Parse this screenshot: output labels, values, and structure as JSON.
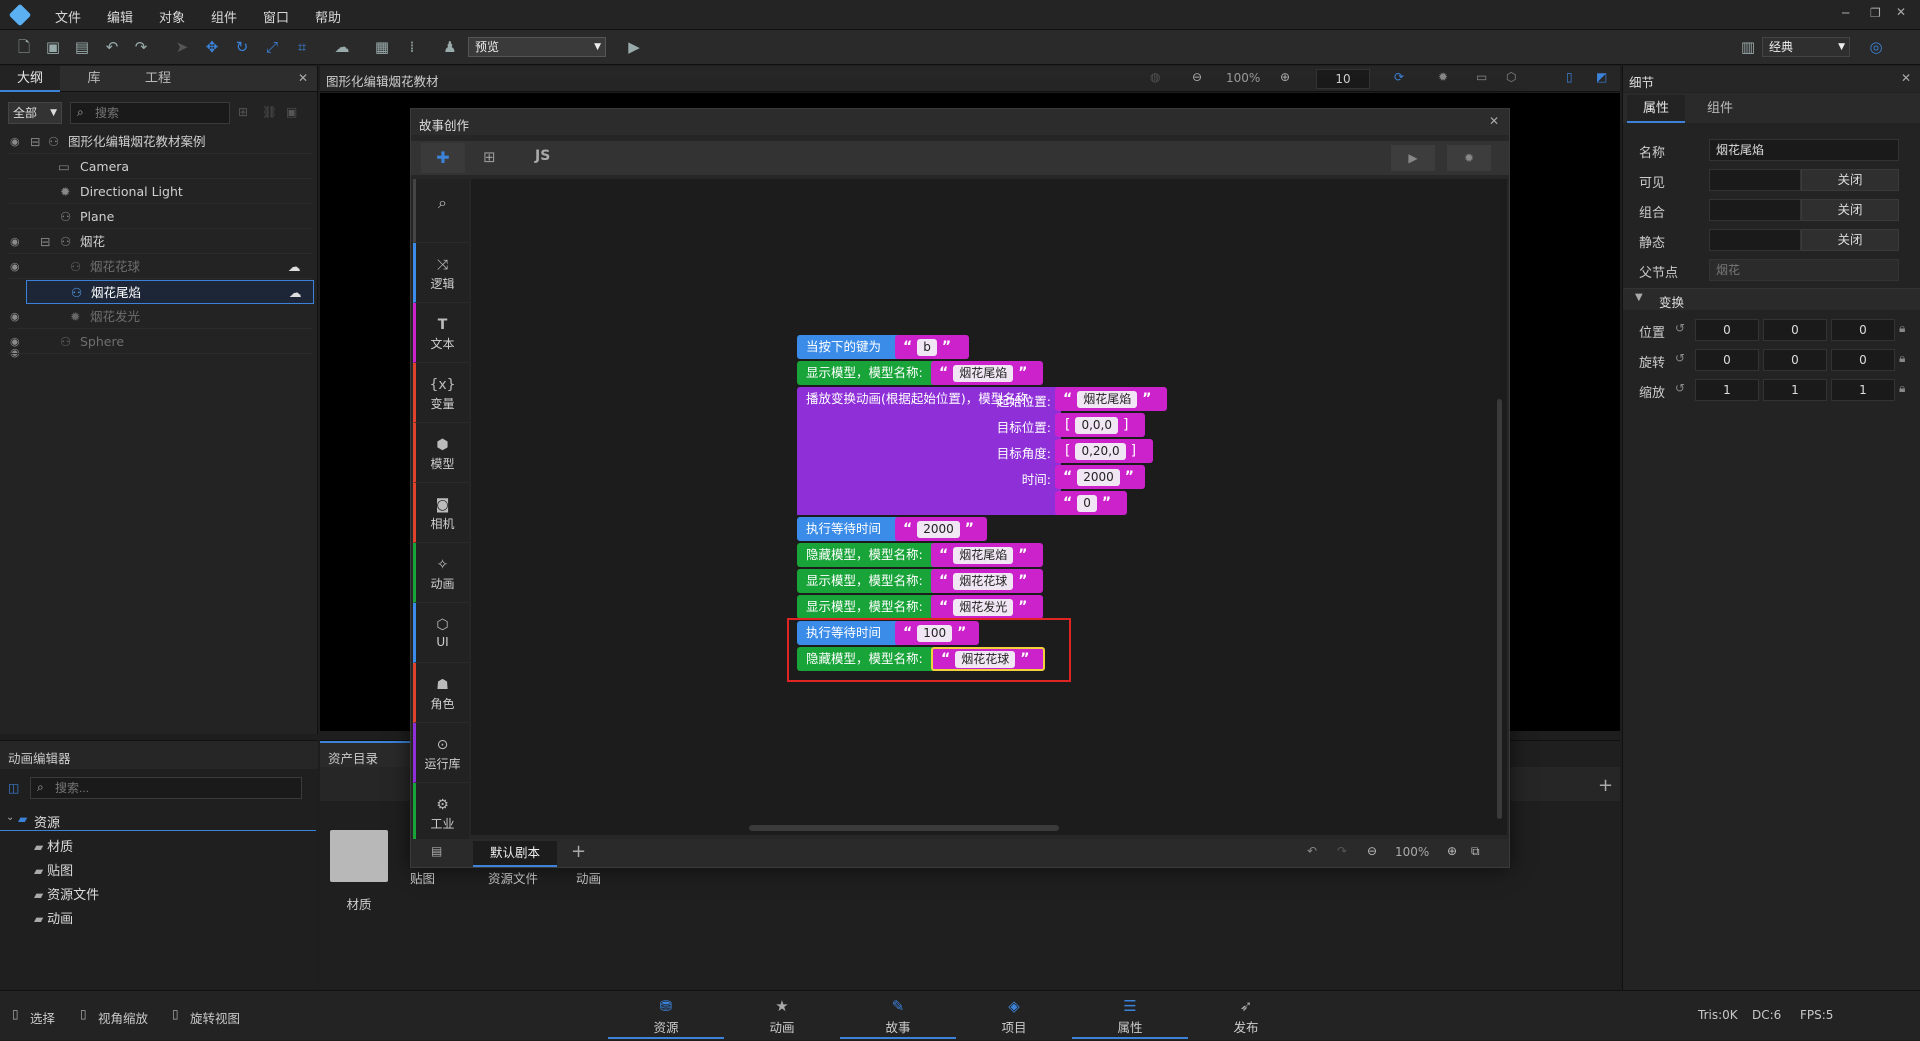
{
  "menu": [
    "文件",
    "编辑",
    "对象",
    "组件",
    "窗口",
    "帮助"
  ],
  "toolbar": {
    "preview_select": "预览",
    "layout_select": "经典"
  },
  "left_panel": {
    "tabs": [
      "大纲",
      "库",
      "工程"
    ],
    "filter_select": "全部",
    "search_placeholder": "搜索",
    "tree": [
      {
        "label": "图形化编辑烟花教材案例",
        "icon": "group-icon",
        "dim": false
      },
      {
        "label": "Camera",
        "icon": "camera-icon",
        "dim": false
      },
      {
        "label": "Directional Light",
        "icon": "light-icon",
        "dim": false
      },
      {
        "label": "Plane",
        "icon": "mesh-icon",
        "dim": false
      },
      {
        "label": "烟花",
        "icon": "mesh-icon",
        "dim": false
      },
      {
        "label": "烟花花球",
        "icon": "mesh-icon",
        "dim": true
      },
      {
        "label": "烟花尾焰",
        "icon": "mesh-icon",
        "dim": false,
        "selected": true
      },
      {
        "label": "烟花发光",
        "icon": "light-icon",
        "dim": true
      },
      {
        "label": "Sphere",
        "icon": "mesh-icon",
        "dim": true
      }
    ]
  },
  "viewport": {
    "title": "图形化编辑烟花教材",
    "zoom": "100%",
    "grid_value": "10"
  },
  "anim_panel": {
    "title": "动画编辑器",
    "search_placeholder": "搜索..."
  },
  "assets": {
    "tab": "资产目录",
    "tree_root": "资源",
    "tree_children": [
      "材质",
      "贴图",
      "资源文件",
      "动画"
    ],
    "folders": [
      "材质",
      "贴图",
      "资源文件",
      "动画"
    ]
  },
  "story": {
    "title": "故事创作",
    "tab_js": "JS",
    "categories": [
      "",
      "逻辑",
      "文本",
      "变量",
      "模型",
      "相机",
      "动画",
      "UI",
      "角色",
      "运行库",
      "工业"
    ],
    "script_tab": "默认剧本",
    "zoom": "100%",
    "blocks": {
      "b1_label": "当按下的键为",
      "b1_value": "b",
      "b2_label": "显示模型，模型名称:",
      "b2_value": "烟花尾焰",
      "b3_label": "播放变换动画(根据起始位置)，模型名称:",
      "b3_value": "烟花尾焰",
      "b3_start_label": "起始位置:",
      "b3_start_value": "0,0,0",
      "b3_target_label": "目标位置:",
      "b3_target_value": "0,20,0",
      "b3_angle_label": "目标角度:",
      "b3_angle_value": "2000",
      "b3_time_label": "时间:",
      "b3_time_value": "0",
      "b4_label": "执行等待时间",
      "b4_value": "2000",
      "b5_label": "隐藏模型，模型名称:",
      "b5_value": "烟花尾焰",
      "b6_label": "显示模型，模型名称:",
      "b6_value": "烟花花球",
      "b7_label": "显示模型，模型名称:",
      "b7_value": "烟花发光",
      "b8_label": "执行等待时间",
      "b8_value": "100",
      "b9_label": "隐藏模型，模型名称:",
      "b9_value": "烟花花球"
    }
  },
  "details": {
    "title": "细节",
    "tabs": [
      "属性",
      "组件"
    ],
    "name_label": "名称",
    "name_value": "烟花尾焰",
    "visible_label": "可见",
    "visible_value": "关闭",
    "group_label": "组合",
    "group_value": "关闭",
    "static_label": "静态",
    "static_value": "关闭",
    "parent_label": "父节点",
    "parent_value": "烟花",
    "transform_title": "变换",
    "position_label": "位置",
    "position": [
      "0",
      "0",
      "0"
    ],
    "rotation_label": "旋转",
    "rotation": [
      "0",
      "0",
      "0"
    ],
    "scale_label": "缩放",
    "scale": [
      "1",
      "1",
      "1"
    ]
  },
  "status": {
    "select": "选择",
    "zoom_view": "视角缩放",
    "rotate_view": "旋转视图",
    "tris": "Tris:0K",
    "dc": "DC:6",
    "fps": "FPS:5"
  },
  "bottom_tabs": [
    "资源",
    "动画",
    "故事",
    "项目",
    "属性",
    "发布"
  ],
  "colors": {
    "accent": "#3b82d8",
    "block_blue": "#3b8ce8",
    "block_green": "#19a43a",
    "block_purple": "#8e2fd8",
    "block_string": "#cc22cc",
    "highlight": "#e02424"
  }
}
